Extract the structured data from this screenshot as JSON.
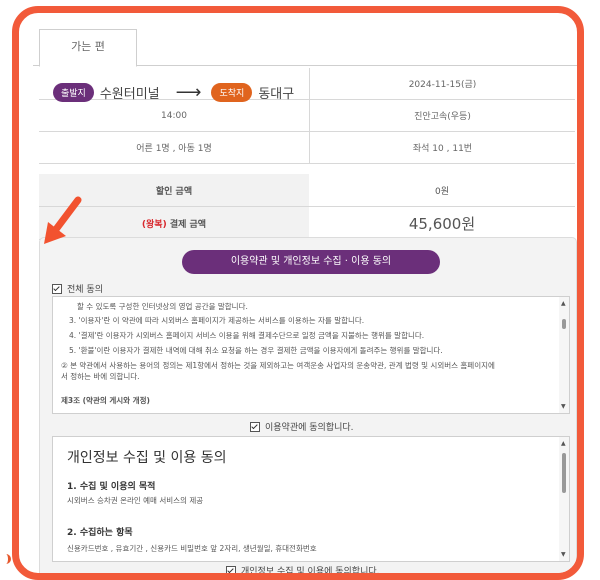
{
  "tab": {
    "label": "가는 편"
  },
  "route": {
    "dep_badge": "출발지",
    "dep_name": "수원터미널",
    "arrow": "⟶",
    "arr_badge": "도착지",
    "arr_name": "동대구"
  },
  "info": {
    "date": "2024-11-15(금)",
    "time": "14:00",
    "bus": "진안고속(우등)",
    "passengers": "어른 1명 , 아동 1명",
    "seats": "좌석 10 , 11번"
  },
  "price": {
    "discount_label": "할인 금액",
    "discount_value": "0원",
    "total_prefix": "(왕복)",
    "total_label": "결제 금액",
    "total_value": "45,600원"
  },
  "agreement": {
    "header_button": "이용약관 및 개인정보 수집 · 이용 동의",
    "all_agree": "전체 동의",
    "terms_lines": [
      "할 수 있도록 구성한 인터넷상의 영업 공간을 말합니다.",
      "3. '이용자'란 이 약관에 따라 시외버스 홈페이지가 제공하는 서비스를 이용하는 자를 말합니다.",
      "4. '결제'란 이용자가 시외버스 홈페이지 서비스 이용을 위해 결제수단으로 일정 금액을 지불하는 행위를 말합니다.",
      "5. '환불'이란 이용자가 결제한 내역에 대해 취소 요청을 하는 경우 결제한 금액을 이용자에게 돌려주는 행위를 말합니다.",
      "② 본 약관에서 사용하는 용어의 정의는 제1항에서 정하는 것을 제외하고는 여객운송 사업자의 운송약관, 관계 법령 및 시외버스 홈페이지에",
      "서 정하는 바에 의합니다.",
      "제3조 (약관의 게시와 개정)"
    ],
    "terms_agree": "이용약관에 동의합니다.",
    "privacy_title": "개인정보 수집 및 이용 동의",
    "privacy_sec1": "1. 수집 및 이용의 목적",
    "privacy_text1": "시외버스 승차권 온라인 예매 서비스의 제공",
    "privacy_sec2": "2. 수집하는 항목",
    "privacy_text2": "신용카드번호 , 유효기간 , 신용카드 비밀번호 앞 2자리, 생년월일, 휴대전화번호",
    "privacy_agree": "개인정보 수집 및 이용에 동의합니다."
  },
  "colors": {
    "frame": "#f25a3a",
    "purple": "#6b2f7a",
    "orange": "#e0641e",
    "red": "#d8282d"
  }
}
